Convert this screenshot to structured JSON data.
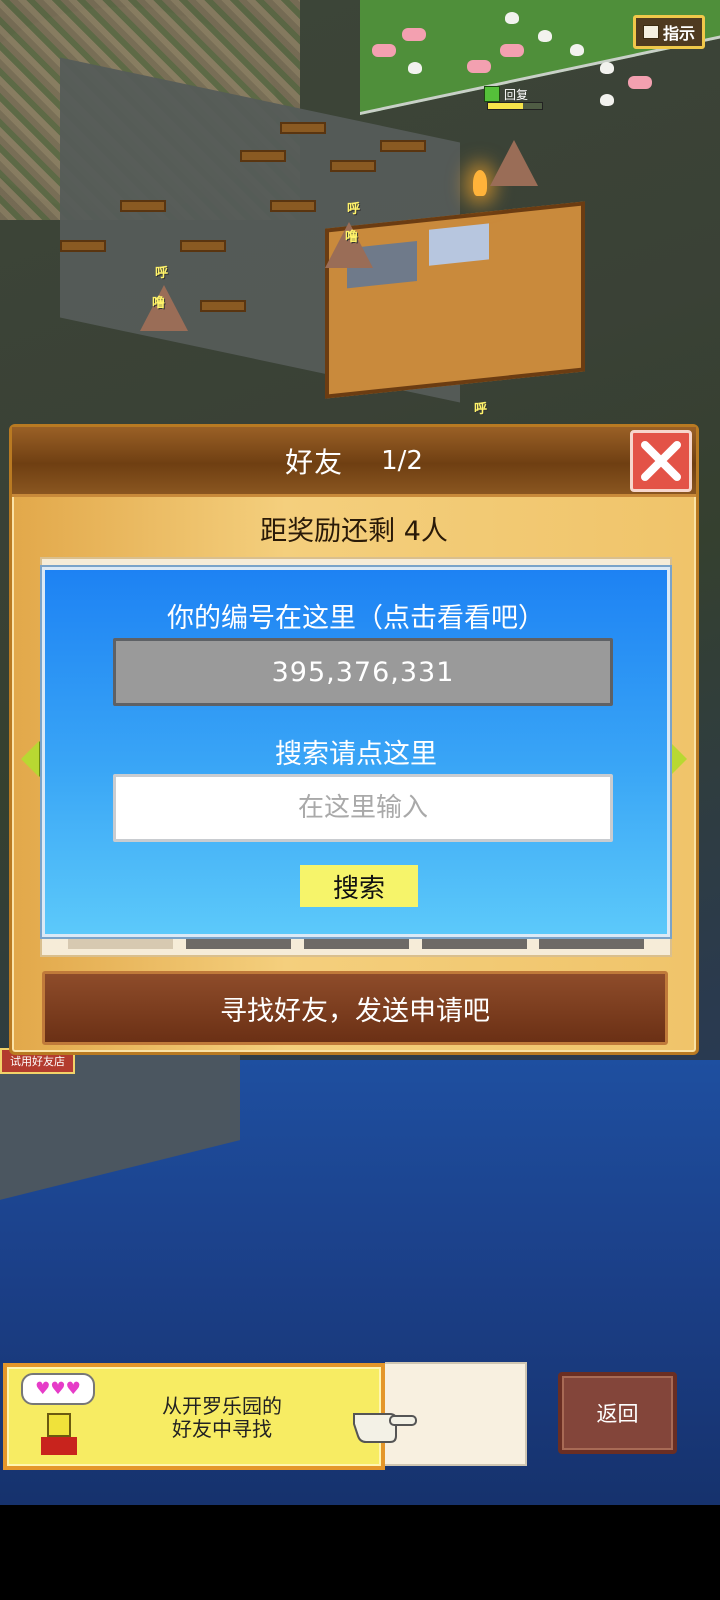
{
  "hud": {
    "hint_label": "指示",
    "recovery_label": "回复",
    "recovery_progress": 0.65,
    "trial_shop_label": "试用好友店",
    "world_marks": [
      "呼",
      "噜",
      "呼",
      "噜",
      "呼"
    ]
  },
  "dialog": {
    "title": "好友",
    "page": "1/2",
    "reward_text": "距奖励还剩 4人",
    "id_heading": "你的编号在这里（点击看看吧）",
    "player_id": "395,376,331",
    "search_heading": "搜索请点这里",
    "search_placeholder": "在这里输入",
    "search_value": "",
    "search_button": "搜索",
    "find_friends_button": "寻找好友，发送申请吧",
    "friend_slots": 5
  },
  "bottom": {
    "helper_bubble": "♥♥♥",
    "helper_text_line1": "从开罗乐园的",
    "helper_text_line2": "好友中寻找",
    "back_button": "返回"
  },
  "colors": {
    "dialog_header": "#6f3f12",
    "panel_blue": "#1d82f3",
    "search_button": "#f6f46a",
    "close_button": "#e35347",
    "find_button": "#6b3015",
    "helper_bar": "#f7ec63",
    "back_button": "#83453a"
  },
  "icons": [
    "book-icon",
    "close-x-icon",
    "arrow-left-icon",
    "arrow-right-icon",
    "pointing-hand-icon",
    "mascot-icon"
  ]
}
